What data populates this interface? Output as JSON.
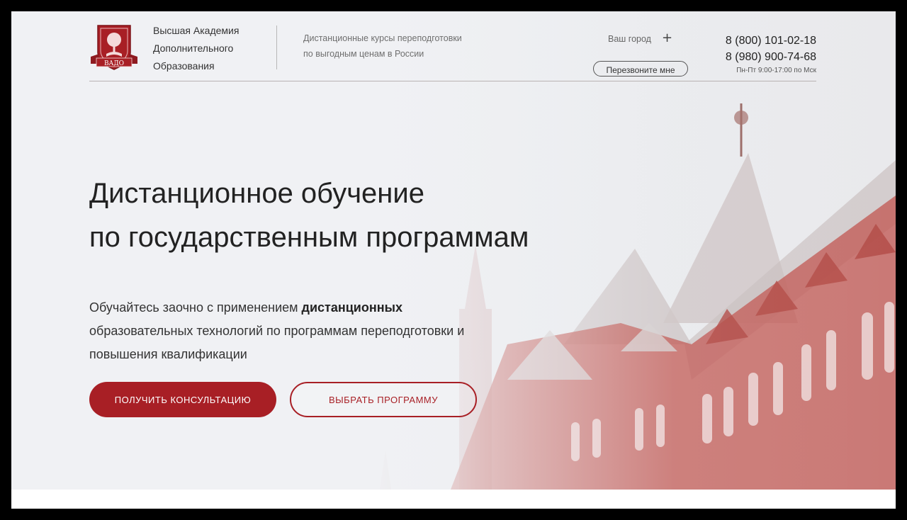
{
  "brand": {
    "name_lines": [
      "Высшая Академия",
      "Дополнительного",
      "Образования"
    ],
    "logo_text": "ВАДО"
  },
  "header": {
    "tagline_lines": [
      "Дистанционные курсы переподготовки",
      "по выгодным ценам в России"
    ],
    "city_label": "Ваш город",
    "city_plus": "+",
    "callback_label": "Перезвоните мне",
    "phones": [
      "8 (800) 101-02-18",
      "8 (980) 900-74-68"
    ],
    "hours": "Пн-Пт 9:00-17:00 по Мск"
  },
  "hero": {
    "title_lines": [
      "Дистанционное обучение",
      "по государственным программам"
    ],
    "lead_before": "Обучайтесь заочно с применением ",
    "lead_bold": "дистанционных",
    "lead_after": " образовательных технологий по программам переподготовки и повышения квалификации",
    "primary_button": "ПОЛУЧИТЬ КОНСУЛЬТАЦИЮ",
    "secondary_button": "ВЫБРАТЬ ПРОГРАММУ"
  },
  "colors": {
    "accent": "#a81f25",
    "building_brick": "#c25a55",
    "background": "#f1f2f5"
  }
}
